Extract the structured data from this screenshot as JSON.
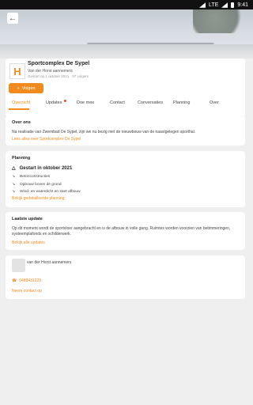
{
  "status_bar": {
    "network": "LTE",
    "time": "9:41"
  },
  "project": {
    "name": "Sportcomplex De Sypel",
    "organization": "Van der Horst aannemers",
    "meta": "Gestart op 1 oktober 2021 · 97 volgers",
    "follow_label": "Volgen"
  },
  "tabs": [
    "Overzicht",
    "Updates",
    "Doe mee",
    "Contact",
    "Conversaties",
    "Planning",
    "Over"
  ],
  "about": {
    "title": "Over ons",
    "text": "Na realisatie van Zwembad De Sypel, zijn we nu bezig met de nieuwbouw van de naastgelegen sporthal.",
    "link": "Lees alles over Sportcomplex De Sypel"
  },
  "planning": {
    "title": "Planning",
    "current": "Gestart in oktober 2021",
    "items": [
      "Betonconstructies",
      "Opbouw boven de grond",
      "Wind- en waterdicht en start afbouw"
    ],
    "link": "Bekijk gedetailleerde planning"
  },
  "latest": {
    "title": "Laatste update",
    "text": "Op dit moment wordt de sportvloer aangebracht en is de afbouw in volle gang. Ruimtes worden voorzien van betimmeringen, systeemplafonds en schilderwerk.",
    "link": "Bekijk alle updates"
  },
  "contact": {
    "name": "van der Horst aannemers",
    "phone": "0488431220",
    "link": "Neem contact op"
  },
  "colors": {
    "accent": "#f28b1d",
    "background": "#efefef",
    "card": "#ffffff"
  }
}
